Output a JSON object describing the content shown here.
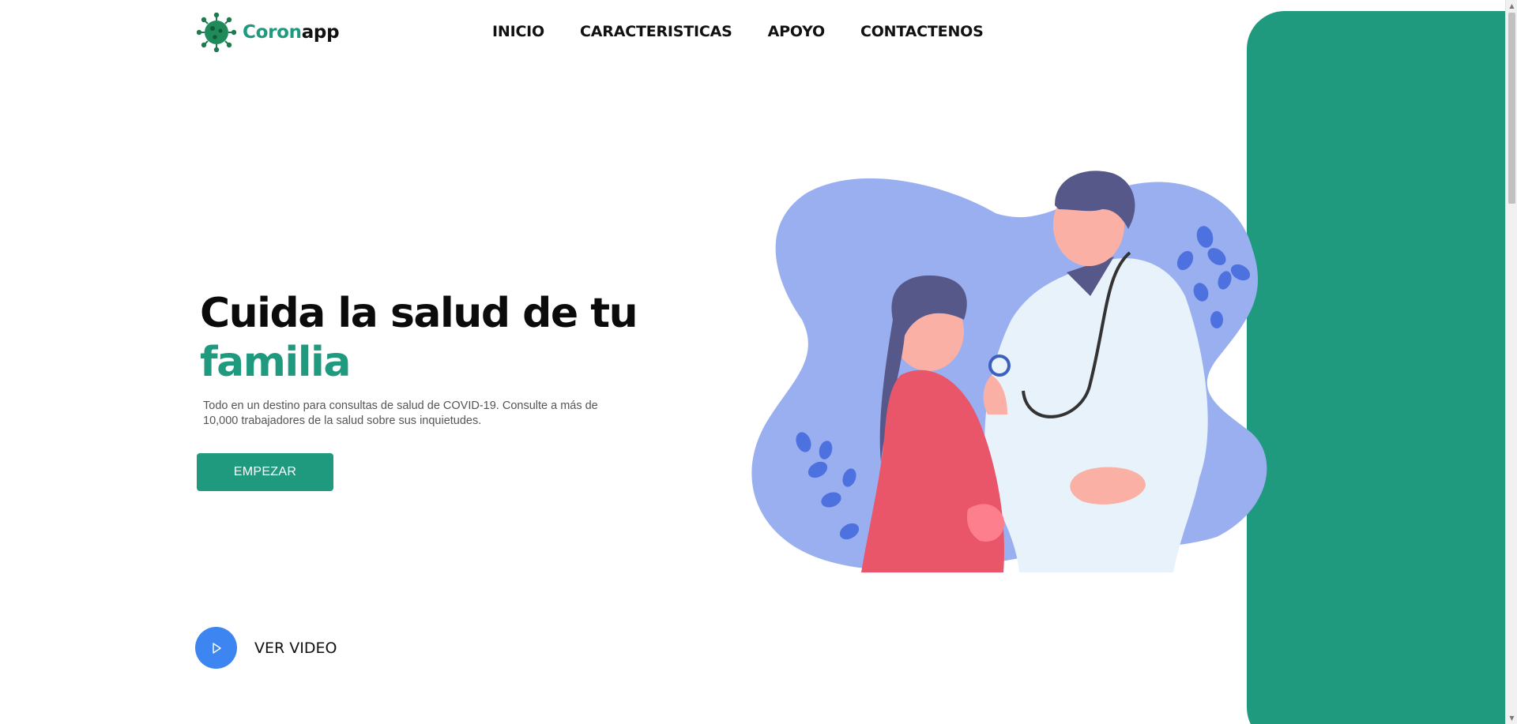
{
  "brand": {
    "name_part1": "Coron",
    "name_part2": "app"
  },
  "nav": {
    "items": [
      {
        "label": "INICIO"
      },
      {
        "label": "CARACTERISTICAS"
      },
      {
        "label": "APOYO"
      },
      {
        "label": "CONTACTENOS"
      }
    ]
  },
  "hero": {
    "title_line1": "Cuida la salud de tu",
    "title_line2": "familia",
    "description": "Todo en un destino para consultas de salud de COVID-19. Consulte a más de 10,000 trabajadores de la salud sobre sus inquietudes.",
    "cta_label": "EMPEZAR"
  },
  "video": {
    "label": "VER VIDEO"
  },
  "colors": {
    "primary_green": "#1f9a7f",
    "play_blue": "#3d85f0",
    "blob_purple": "#9aaff0",
    "text_dark": "#111111"
  },
  "icons": {
    "logo": "virus-icon",
    "play": "play-icon"
  }
}
